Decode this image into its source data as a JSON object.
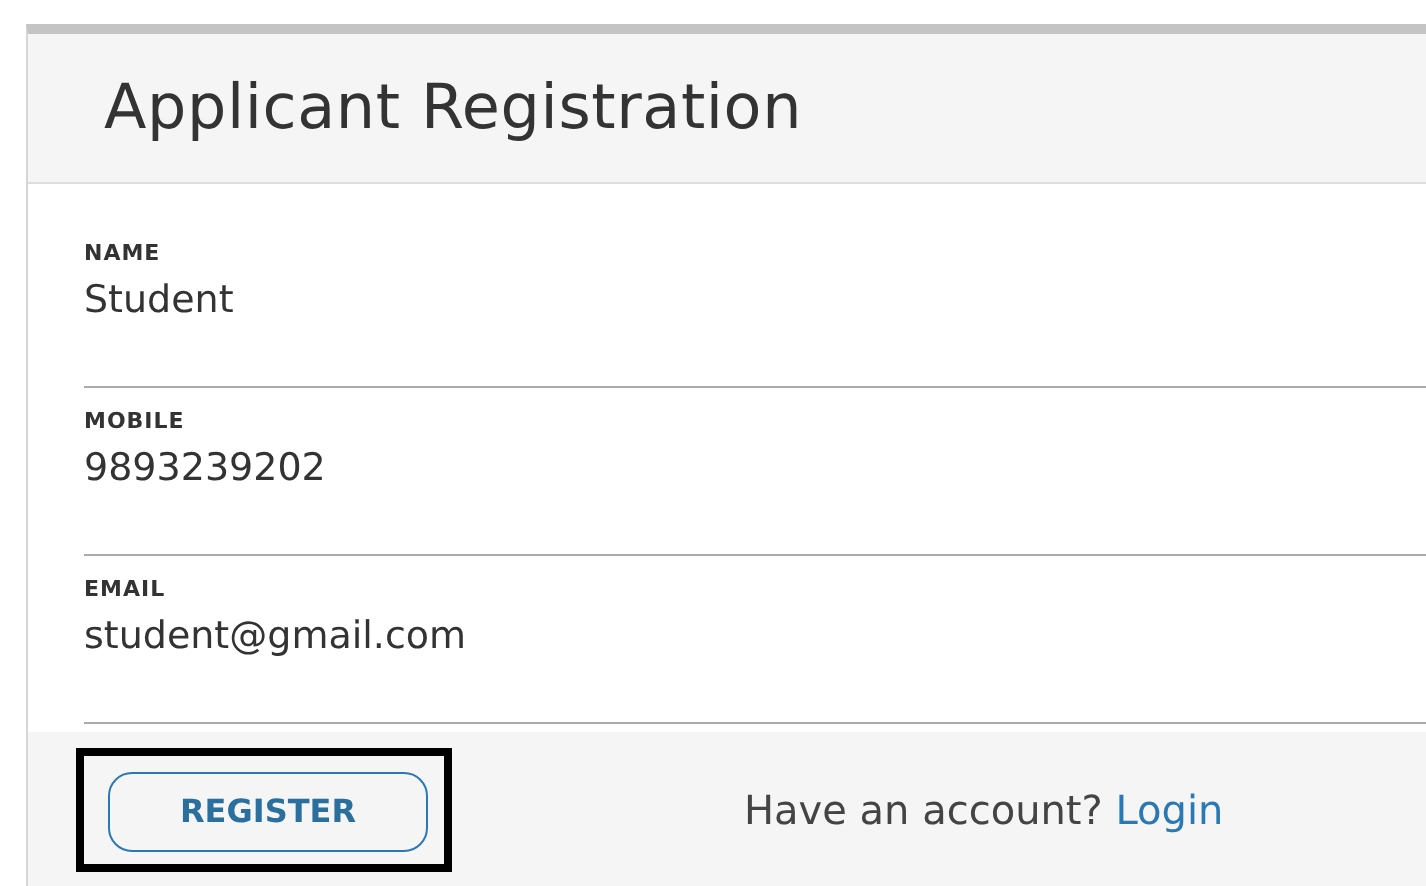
{
  "title": "Applicant Registration",
  "fields": [
    {
      "label": "NAME",
      "value": "Student"
    },
    {
      "label": "MOBILE",
      "value": "9893239202"
    },
    {
      "label": "EMAIL",
      "value": "student@gmail.com"
    }
  ],
  "register_button": {
    "label": "REGISTER",
    "highlighted": true
  },
  "login_prompt": {
    "text": "Have an account?",
    "link": "Login"
  }
}
